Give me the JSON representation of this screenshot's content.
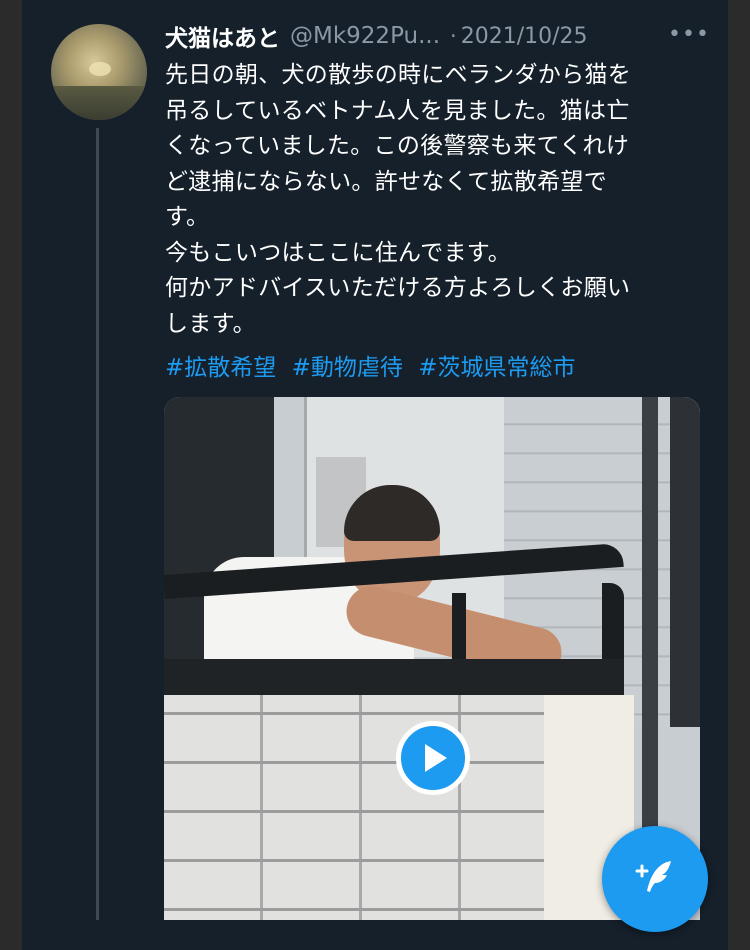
{
  "tweet": {
    "display_name": "犬猫はあと",
    "handle": "@Mk922Pu...",
    "separator": "·",
    "date": "2021/10/25",
    "more_label": "•••",
    "text_lines": [
      "先日の朝、犬の散歩の時にベランダから猫を",
      "吊るしているベトナム人を見ました。猫は亡",
      "くなっていました。この後警察も来てくれけ",
      "ど逮捕にならない。許せなくて拡散希望で",
      "す。",
      "今もこいつはここに住んでます。",
      "何かアドバイスいただける方よろしくお願い",
      "します。"
    ],
    "hashtags": [
      "#拡散希望",
      "#動物虐待",
      "#茨城県常総市"
    ]
  },
  "media": {
    "type": "video",
    "play_icon": "play-icon"
  },
  "compose_button": {
    "icon": "compose-feather-icon"
  },
  "colors": {
    "background": "#15202b",
    "accent": "#1d9bf0",
    "secondary_text": "#8b98a5"
  }
}
